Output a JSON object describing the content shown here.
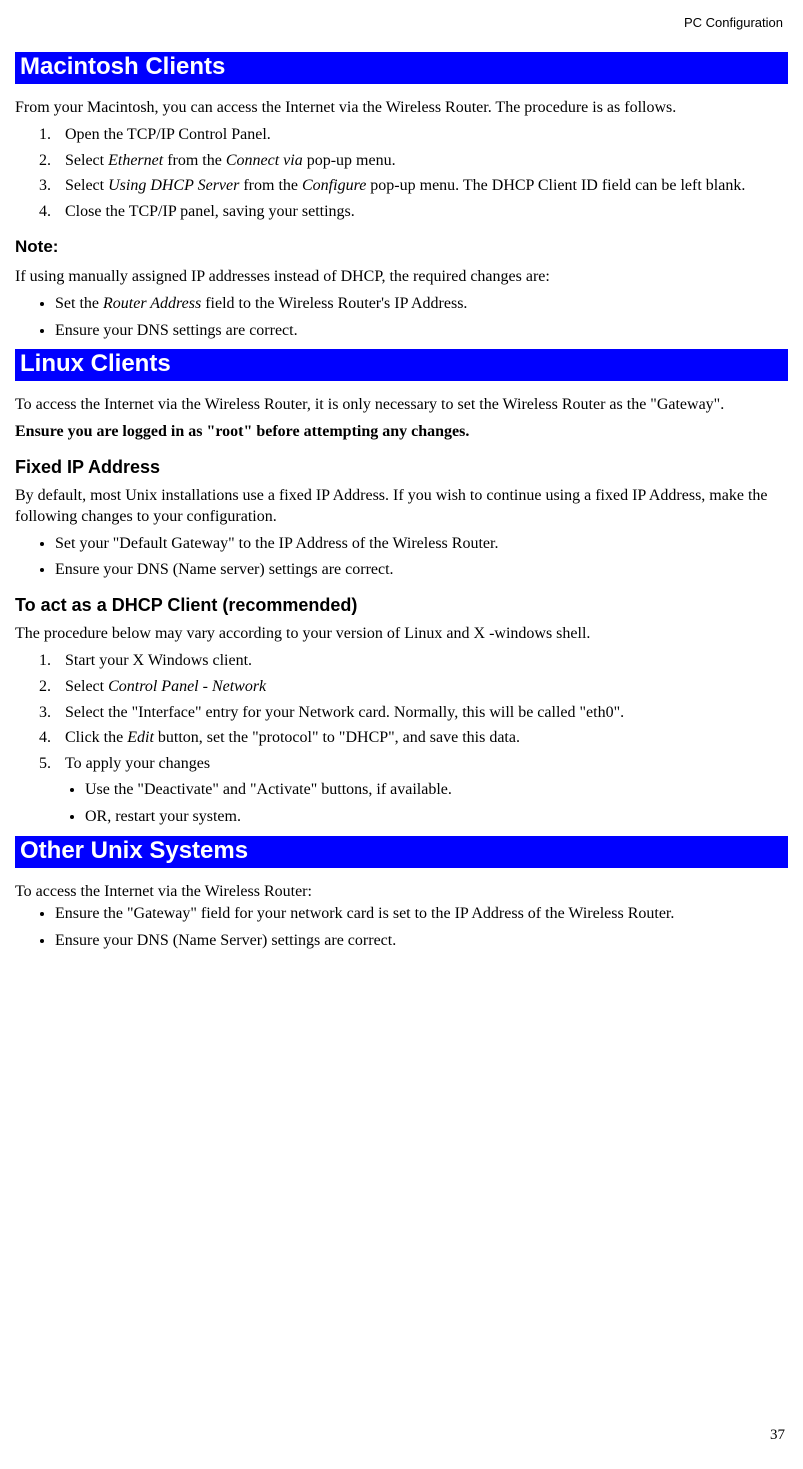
{
  "header": {
    "label": "PC Configuration"
  },
  "mac": {
    "heading": "Macintosh Clients",
    "intro": "From your Macintosh, you can access the Internet via the Wireless Router. The procedure is as follows.",
    "steps": {
      "s1": "Open the TCP/IP Control Panel.",
      "s2a": "Select ",
      "s2b": "Ethernet",
      "s2c": " from the ",
      "s2d": "Connect via",
      "s2e": " pop-up menu.",
      "s3a": "Select ",
      "s3b": "Using DHCP Server",
      "s3c": " from the ",
      "s3d": "Configure",
      "s3e": " pop-up menu. The DHCP Client ID field can be left blank.",
      "s4": "Close the TCP/IP panel, saving your settings."
    },
    "note_heading": "Note:",
    "note_intro": "If using manually assigned IP addresses instead of DHCP, the required changes are:",
    "note_b1a": "Set the ",
    "note_b1b": "Router Address",
    "note_b1c": " field to the Wireless Router's IP Address.",
    "note_b2": "Ensure your DNS settings are correct."
  },
  "linux": {
    "heading": "Linux Clients",
    "intro": "To access the Internet via the Wireless Router, it is only necessary to set the Wireless Router as the \"Gateway\".",
    "root_warning": "Ensure you are logged in as \"root\" before attempting any changes.",
    "fixed": {
      "heading": "Fixed IP Address",
      "intro": "By default, most Unix installations use a fixed IP Address. If you wish to continue using a fixed IP Address, make the following changes to your configuration.",
      "b1": "Set your \"Default Gateway\" to the IP Address of the Wireless Router.",
      "b2": "Ensure your DNS (Name server) settings are correct."
    },
    "dhcp": {
      "heading": "To act as a DHCP Client (recommended)",
      "intro": "The procedure below may vary according to your version of Linux and X -windows shell.",
      "s1": "Start your X Windows client.",
      "s2a": "Select ",
      "s2b": "Control Panel - Network",
      "s3": "Select the \"Interface\" entry for your Network card. Normally, this will be called \"eth0\".",
      "s4a": "Click the ",
      "s4b": "Edit",
      "s4c": " button, set the \"protocol\" to \"DHCP\", and save this data.",
      "s5": "To apply your changes",
      "s5b1": "Use the \"Deactivate\" and \"Activate\" buttons, if available.",
      "s5b2": "OR, restart your system."
    }
  },
  "unix": {
    "heading": "Other Unix Systems",
    "intro": "To access the Internet via the Wireless Router:",
    "b1": "Ensure the \"Gateway\" field for your network card is set to the IP Address of the Wireless Router.",
    "b2": "Ensure your DNS (Name Server) settings are correct."
  },
  "page_number": "37"
}
